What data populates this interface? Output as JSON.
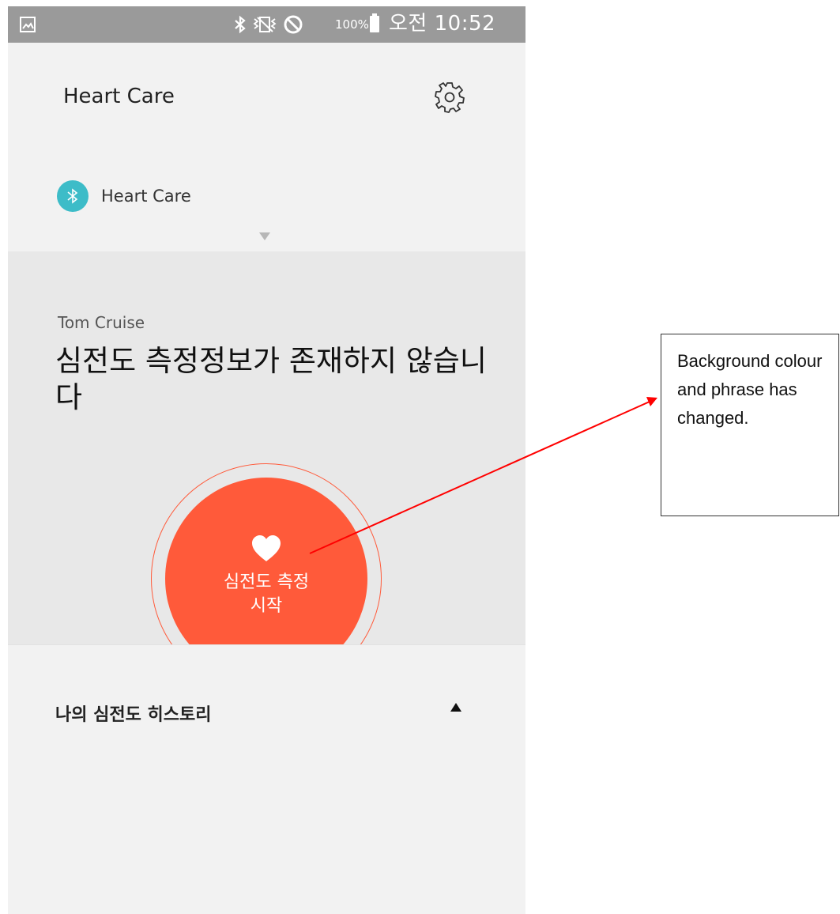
{
  "status_bar": {
    "battery_percent": "100%",
    "clock": "오전 10:52",
    "icons": [
      "gallery-icon",
      "bluetooth-icon",
      "vibrate-icon",
      "blocked-icon",
      "battery-icon"
    ]
  },
  "header": {
    "title": "Heart Care",
    "settings_icon": "gear-icon"
  },
  "device": {
    "name": "Heart Care",
    "icon": "bluetooth-icon",
    "badge_color": "#3dbcc8"
  },
  "main": {
    "user_name": "Tom Cruise",
    "message": "심전도 측정정보가 존재하지 않습니다",
    "start_button": {
      "line1": "심전도 측정",
      "line2": "시작",
      "icon": "heart-icon",
      "color": "#ff5a3a"
    }
  },
  "history": {
    "title": "나의 심전도 히스토리",
    "caret_icon": "caret-up-icon"
  },
  "annotation": {
    "text": "Background colour and phrase has changed.",
    "arrow_color": "#ff0000"
  }
}
